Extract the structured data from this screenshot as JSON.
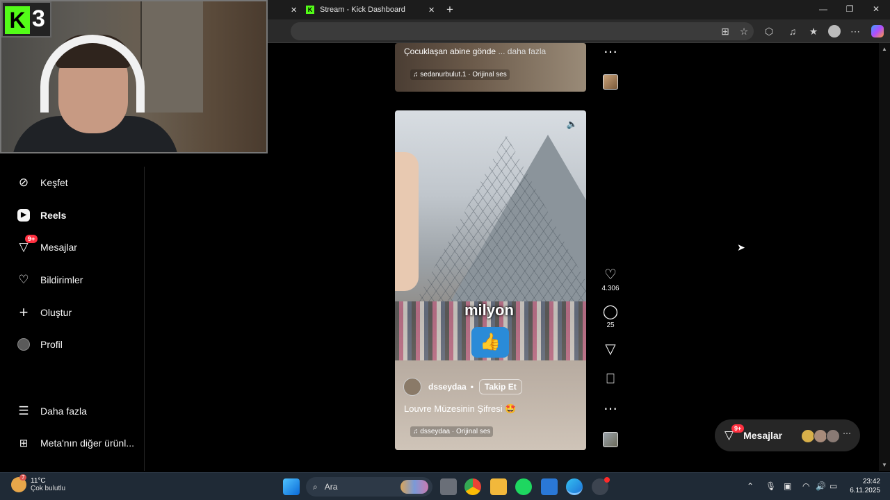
{
  "browser": {
    "tabs": [
      {
        "title": "Stream - Kick Dashboard"
      }
    ],
    "new_tab": "+",
    "close_glyph": "✕"
  },
  "webcam": {
    "badge_number": "3"
  },
  "sidebar": {
    "items": [
      {
        "label": "Keşfet",
        "icon": "compass-icon"
      },
      {
        "label": "Reels",
        "icon": "reels-icon"
      },
      {
        "label": "Mesajlar",
        "icon": "messenger-icon",
        "badge": "9+"
      },
      {
        "label": "Bildirimler",
        "icon": "heart-icon"
      },
      {
        "label": "Oluştur",
        "icon": "plus-icon"
      },
      {
        "label": "Profil",
        "icon": "avatar-icon"
      },
      {
        "label": "Daha fazla",
        "icon": "menu-icon"
      },
      {
        "label": "Meta'nın diğer ürünl...",
        "icon": "apps-icon"
      }
    ]
  },
  "reel_top": {
    "caption": "Çocuklaşan abine gönde",
    "more": "... daha fazla",
    "audio": "sedanurbulut.1 · Orijinal ses"
  },
  "reel_main": {
    "overlay_text": "milyon",
    "username": "dsseydaa",
    "dot": "•",
    "follow": "Takip Et",
    "caption": "Louvre Müzesinin Şifresi 🤩",
    "audio": "dsseydaa · Orijinal ses"
  },
  "actions": {
    "likes": "4.306",
    "comments": "25"
  },
  "messages_pill": {
    "label": "Mesajlar",
    "badge": "9+"
  },
  "taskbar": {
    "search_placeholder": "Ara",
    "weather_temp": "11°C",
    "weather_desc": "Çok bulutlu",
    "weather_badge": "7",
    "time": "23:42",
    "date": "6.11.2025"
  }
}
